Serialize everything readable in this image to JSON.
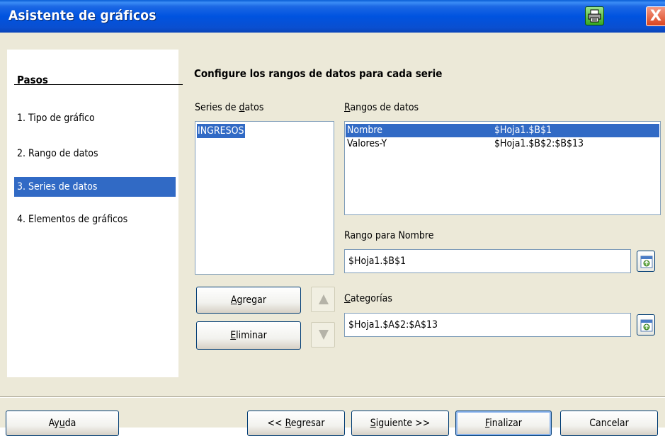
{
  "window": {
    "title": "Asistente de gráficos",
    "close_glyph": "X"
  },
  "steps": {
    "title": "Pasos",
    "items": [
      {
        "label": "1. Tipo de gráfico",
        "active": false
      },
      {
        "label": "2. Rango de datos",
        "active": false
      },
      {
        "label": "3. Series de datos",
        "active": true
      },
      {
        "label": "4. Elementos de gráficos",
        "active": false
      }
    ]
  },
  "main": {
    "heading": "Configure los rangos de datos para cada serie",
    "series_label": {
      "pre": "Series de ",
      "u": "d",
      "post": "atos"
    },
    "series": [
      "INGRESOS"
    ],
    "ranges_label": {
      "pre": "",
      "u": "R",
      "post": "angos de datos"
    },
    "ranges": [
      {
        "name": "Nombre",
        "value": "$Hoja1.$B$1",
        "selected": true
      },
      {
        "name": "Valores-Y",
        "value": "$Hoja1.$B$2:$B$13",
        "selected": false
      }
    ],
    "range_for_label": {
      "pre": "Ran",
      "u": "g",
      "post": "o para Nombre"
    },
    "range_for_value": "$Hoja1.$B$1",
    "categories_label": {
      "pre": "",
      "u": "C",
      "post": "ategorías"
    },
    "categories_value": "$Hoja1.$A$2:$A$13",
    "add_label": {
      "pre": "",
      "u": "A",
      "post": "gregar"
    },
    "remove_label": {
      "pre": "",
      "u": "E",
      "post": "liminar"
    }
  },
  "footer": {
    "help": {
      "pre": "Ay",
      "u": "u",
      "post": "da"
    },
    "back": {
      "pre": "<< ",
      "u": "R",
      "post": "egresar"
    },
    "next": {
      "pre": "",
      "u": "S",
      "post": "iguiente >>"
    },
    "finish": {
      "pre": "",
      "u": "F",
      "post": "inalizar"
    },
    "cancel": {
      "pre": "Cancelar",
      "u": "",
      "post": ""
    }
  },
  "colors": {
    "titlebar": "#0053e0",
    "selection": "#316ac5",
    "dialog_bg": "#ece9d8"
  },
  "icons": [
    "printer-icon",
    "close-icon",
    "range-picker-icon",
    "arrow-up-icon",
    "arrow-down-icon"
  ]
}
